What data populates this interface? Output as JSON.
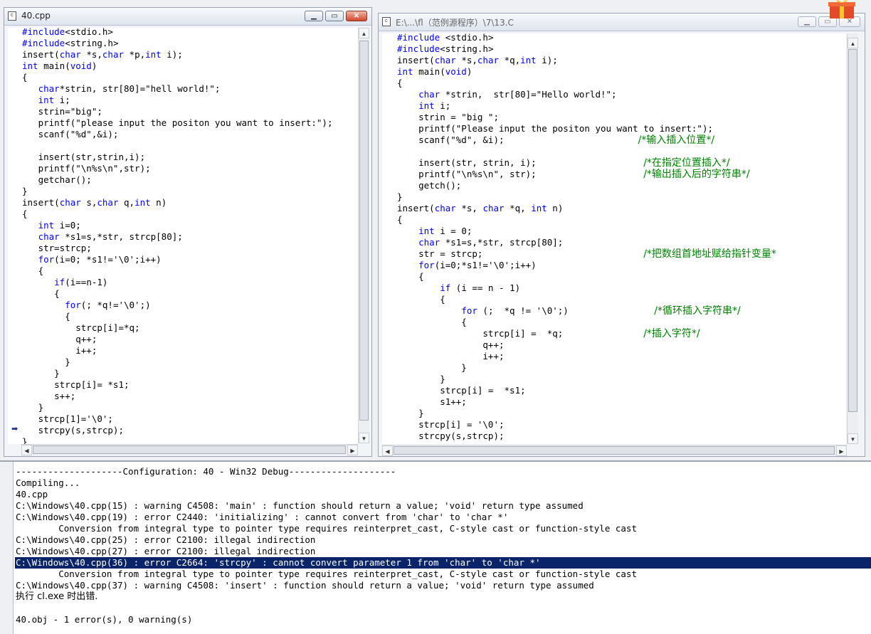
{
  "left_window": {
    "title": "40.cpp",
    "file_icon": "cpp-file-icon",
    "lines": [
      [
        [
          "kw",
          "#include"
        ],
        [
          "t",
          "<stdio.h>"
        ]
      ],
      [
        [
          "kw",
          "#include"
        ],
        [
          "t",
          "<string.h>"
        ]
      ],
      [
        [
          "t",
          "insert("
        ],
        [
          "kw",
          "char"
        ],
        [
          "t",
          " *s,"
        ],
        [
          "kw",
          "char"
        ],
        [
          "t",
          " *p,"
        ],
        [
          "kw",
          "int"
        ],
        [
          "t",
          " i);"
        ]
      ],
      [
        [
          "kw",
          "int"
        ],
        [
          "t",
          " main("
        ],
        [
          "kw",
          "void"
        ],
        [
          "t",
          ")"
        ]
      ],
      [
        [
          "t",
          "{"
        ]
      ],
      [
        [
          "t",
          "   "
        ],
        [
          "kw",
          "char"
        ],
        [
          "t",
          "*strin, str[80]=\"hell world!\";"
        ]
      ],
      [
        [
          "t",
          "   "
        ],
        [
          "kw",
          "int"
        ],
        [
          "t",
          " i;"
        ]
      ],
      [
        [
          "t",
          "   strin=\"big\";"
        ]
      ],
      [
        [
          "t",
          "   printf(\"please input the positon you want to insert:\");"
        ]
      ],
      [
        [
          "t",
          "   scanf(\"%d\",&i);"
        ]
      ],
      [
        [
          "t",
          ""
        ]
      ],
      [
        [
          "t",
          "   insert(str,strin,i);"
        ]
      ],
      [
        [
          "t",
          "   printf(\"\\n%s\\n\",str);"
        ]
      ],
      [
        [
          "t",
          "   getchar();"
        ]
      ],
      [
        [
          "t",
          "}"
        ]
      ],
      [
        [
          "t",
          "insert("
        ],
        [
          "kw",
          "char"
        ],
        [
          "t",
          " s,"
        ],
        [
          "kw",
          "char"
        ],
        [
          "t",
          " q,"
        ],
        [
          "kw",
          "int"
        ],
        [
          "t",
          " n)"
        ]
      ],
      [
        [
          "t",
          "{"
        ]
      ],
      [
        [
          "t",
          "   "
        ],
        [
          "kw",
          "int"
        ],
        [
          "t",
          " i=0;"
        ]
      ],
      [
        [
          "t",
          "   "
        ],
        [
          "kw",
          "char"
        ],
        [
          "t",
          " *s1=s,*str, strcp[80];"
        ]
      ],
      [
        [
          "t",
          "   str=strcp;"
        ]
      ],
      [
        [
          "t",
          "   "
        ],
        [
          "kw",
          "for"
        ],
        [
          "t",
          "(i=0; *s1!='\\0';i++)"
        ]
      ],
      [
        [
          "t",
          "   {"
        ]
      ],
      [
        [
          "t",
          "      "
        ],
        [
          "kw",
          "if"
        ],
        [
          "t",
          "(i==n-1)"
        ]
      ],
      [
        [
          "t",
          "      {"
        ]
      ],
      [
        [
          "t",
          "        "
        ],
        [
          "kw",
          "for"
        ],
        [
          "t",
          "(; *q!='\\0';)"
        ]
      ],
      [
        [
          "t",
          "        {"
        ]
      ],
      [
        [
          "t",
          "          strcp[i]=*q;"
        ]
      ],
      [
        [
          "t",
          "          q++;"
        ]
      ],
      [
        [
          "t",
          "          i++;"
        ]
      ],
      [
        [
          "t",
          "        }"
        ]
      ],
      [
        [
          "t",
          "      }"
        ]
      ],
      [
        [
          "t",
          "      strcp[i]= *s1;"
        ]
      ],
      [
        [
          "t",
          "      s++;"
        ]
      ],
      [
        [
          "t",
          "   }"
        ]
      ],
      [
        [
          "t",
          "   strcp[1]='\\0';"
        ]
      ],
      [
        [
          "t",
          "   strcpy(s,strcp);"
        ]
      ],
      [
        [
          "t",
          "}"
        ]
      ]
    ]
  },
  "right_window": {
    "title": "E:\\...\\fl（范例源程序）\\7\\13.C",
    "file_icon": "c-file-icon",
    "lines": [
      [
        [
          "kw",
          "#include"
        ],
        [
          "t",
          " <stdio.h>"
        ]
      ],
      [
        [
          "kw",
          "#include"
        ],
        [
          "t",
          "<string.h>"
        ]
      ],
      [
        [
          "t",
          "insert("
        ],
        [
          "kw",
          "char"
        ],
        [
          "t",
          " *s,"
        ],
        [
          "kw",
          "char"
        ],
        [
          "t",
          " *q,"
        ],
        [
          "kw",
          "int"
        ],
        [
          "t",
          " i);"
        ]
      ],
      [
        [
          "kw",
          "int"
        ],
        [
          "t",
          " main("
        ],
        [
          "kw",
          "void"
        ],
        [
          "t",
          ")"
        ]
      ],
      [
        [
          "t",
          "{"
        ]
      ],
      [
        [
          "t",
          "    "
        ],
        [
          "kw",
          "char"
        ],
        [
          "t",
          " *strin,  str[80]=\"Hello world!\";"
        ]
      ],
      [
        [
          "t",
          "    "
        ],
        [
          "kw",
          "int"
        ],
        [
          "t",
          " i;"
        ]
      ],
      [
        [
          "t",
          "    strin = \"big \";"
        ]
      ],
      [
        [
          "t",
          "    printf(\"Please input the positon you want to insert:\");"
        ]
      ],
      [
        [
          "t",
          "    scanf(\"%d\", &i);                         "
        ],
        [
          "cm",
          "/*输入插入位置*/"
        ]
      ],
      [
        [
          "t",
          ""
        ]
      ],
      [
        [
          "t",
          "    insert(str, strin, i);                    "
        ],
        [
          "cm",
          "/*在指定位置插入*/"
        ]
      ],
      [
        [
          "t",
          "    printf(\"\\n%s\\n\", str);                    "
        ],
        [
          "cm",
          "/*输出插入后的字符串*/"
        ]
      ],
      [
        [
          "t",
          "    getch();"
        ]
      ],
      [
        [
          "t",
          "}"
        ]
      ],
      [
        [
          "t",
          "insert("
        ],
        [
          "kw",
          "char"
        ],
        [
          "t",
          " *s, "
        ],
        [
          "kw",
          "char"
        ],
        [
          "t",
          " *q, "
        ],
        [
          "kw",
          "int"
        ],
        [
          "t",
          " n)"
        ]
      ],
      [
        [
          "t",
          "{"
        ]
      ],
      [
        [
          "t",
          "    "
        ],
        [
          "kw",
          "int"
        ],
        [
          "t",
          " i = 0;"
        ]
      ],
      [
        [
          "t",
          "    "
        ],
        [
          "kw",
          "char"
        ],
        [
          "t",
          " *s1=s,*str, strcp[80];"
        ]
      ],
      [
        [
          "t",
          "    str = strcp;                              "
        ],
        [
          "cm",
          "/*把数组首地址赋给指针变量*"
        ]
      ],
      [
        [
          "t",
          "    "
        ],
        [
          "kw",
          "for"
        ],
        [
          "t",
          "(i=0;*s1!='\\0';i++)"
        ]
      ],
      [
        [
          "t",
          "    {"
        ]
      ],
      [
        [
          "t",
          "        "
        ],
        [
          "kw",
          "if"
        ],
        [
          "t",
          " (i == n - 1)"
        ]
      ],
      [
        [
          "t",
          "        {"
        ]
      ],
      [
        [
          "t",
          "            "
        ],
        [
          "kw",
          "for"
        ],
        [
          "t",
          " (;  *q != '\\0';)                "
        ],
        [
          "cm",
          "/*循环插入字符串*/"
        ]
      ],
      [
        [
          "t",
          "            {"
        ]
      ],
      [
        [
          "t",
          "                strcp[i] =  *q;               "
        ],
        [
          "cm",
          "/*插入字符*/"
        ]
      ],
      [
        [
          "t",
          "                q++;"
        ]
      ],
      [
        [
          "t",
          "                i++;"
        ]
      ],
      [
        [
          "t",
          "            }"
        ]
      ],
      [
        [
          "t",
          "        }"
        ]
      ],
      [
        [
          "t",
          "        strcp[i] =  *s1;"
        ]
      ],
      [
        [
          "t",
          "        s1++;"
        ]
      ],
      [
        [
          "t",
          "    }"
        ]
      ],
      [
        [
          "t",
          "    strcp[i] = '\\0';"
        ]
      ],
      [
        [
          "t",
          "    strcpy(s,strcp);"
        ]
      ]
    ]
  },
  "output": {
    "lines": [
      "--------------------Configuration: 40 - Win32 Debug--------------------",
      "Compiling...",
      "40.cpp",
      "C:\\Windows\\40.cpp(15) : warning C4508: 'main' : function should return a value; 'void' return type assumed",
      "C:\\Windows\\40.cpp(19) : error C2440: 'initializing' : cannot convert from 'char' to 'char *'",
      "        Conversion from integral type to pointer type requires reinterpret_cast, C-style cast or function-style cast",
      "C:\\Windows\\40.cpp(25) : error C2100: illegal indirection",
      "C:\\Windows\\40.cpp(27) : error C2100: illegal indirection",
      "C:\\Windows\\40.cpp(36) : error C2664: 'strcpy' : cannot convert parameter 1 from 'char' to 'char *'",
      "        Conversion from integral type to pointer type requires reinterpret_cast, C-style cast or function-style cast",
      "C:\\Windows\\40.cpp(37) : warning C4508: 'insert' : function should return a value; 'void' return type assumed",
      "执行 cl.exe 时出错.",
      "",
      "40.obj - 1 error(s), 0 warning(s)"
    ],
    "selected_line": 8
  },
  "window_buttons": {
    "minimize": "▁",
    "maximize": "▭",
    "close": "✕"
  },
  "scroll_glyphs": {
    "up": "▲",
    "down": "▼",
    "left": "◀",
    "right": "▶"
  },
  "marker_glyph": "➡"
}
